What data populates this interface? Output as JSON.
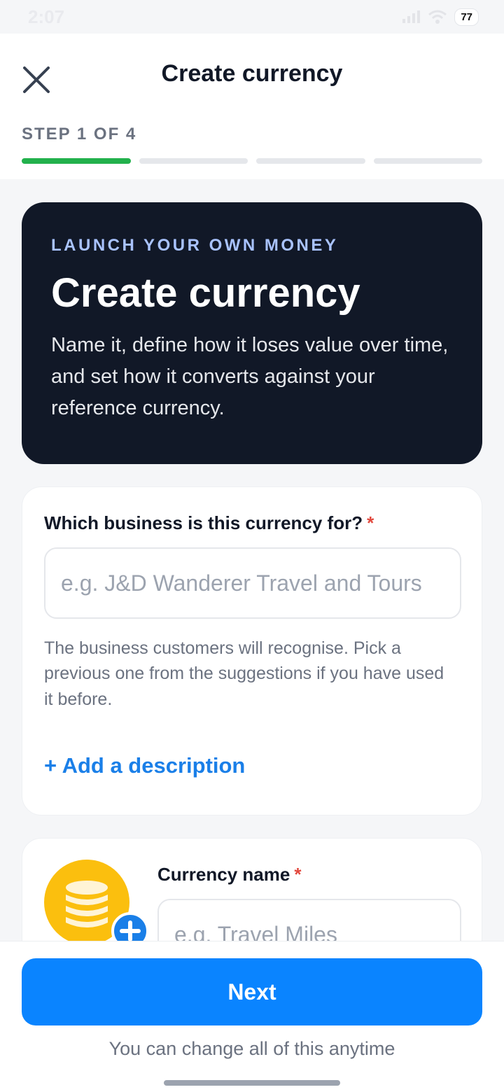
{
  "status_bar": {
    "time": "2:07",
    "battery": "77"
  },
  "header": {
    "title": "Create currency",
    "step_label": "STEP 1 OF 4",
    "progress": {
      "current_step": 1,
      "total_steps": 4
    }
  },
  "hero": {
    "eyebrow": "LAUNCH YOUR OWN MONEY",
    "title": "Create currency",
    "body": "Name it, define how it loses value over time, and set how it converts against your reference currency."
  },
  "business_card": {
    "label": "Which business is this currency for?",
    "required_mark": "*",
    "placeholder": "e.g. J&D Wanderer Travel and Tours",
    "helper": "The business customers will recognise. Pick a previous one from the suggestions if you have used it before.",
    "add_description": "+ Add a description"
  },
  "currency_card": {
    "label": "Currency name",
    "required_mark": "*",
    "placeholder": "e.g. Travel Miles"
  },
  "footer": {
    "next_label": "Next",
    "note": "You can change all of this anytime"
  },
  "colors": {
    "accent": "#0a84ff",
    "progress_active": "#22b14c",
    "hero_bg": "#111827",
    "coin": "#fbbf0e",
    "required": "#e2483d"
  },
  "icons": [
    "close-icon",
    "coin-stack-icon",
    "plus-icon",
    "wifi-icon",
    "signal-icon",
    "battery-icon"
  ]
}
